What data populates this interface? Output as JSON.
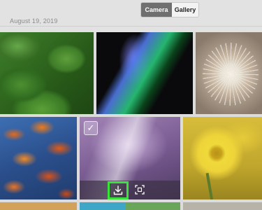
{
  "header": {
    "date": "August 19, 2019",
    "tabs": [
      {
        "label": "Camera",
        "active": true
      },
      {
        "label": "Gallery",
        "active": false
      }
    ]
  },
  "grid": {
    "photos": [
      {
        "subject": "green succulent"
      },
      {
        "subject": "abstract blue-green brushstroke"
      },
      {
        "subject": "dandelion seed head"
      },
      {
        "subject": "orange autumn leaves"
      },
      {
        "subject": "purple abstract",
        "selected": true
      },
      {
        "subject": "yellow flower"
      }
    ],
    "selected_overlay": {
      "checkmark": "✓",
      "actions": [
        "download-icon",
        "crop-icon"
      ]
    }
  },
  "colors": {
    "tab_active_bg": "#6f6f6f",
    "highlight": "#3be23b",
    "background": "#dcdcdc"
  }
}
